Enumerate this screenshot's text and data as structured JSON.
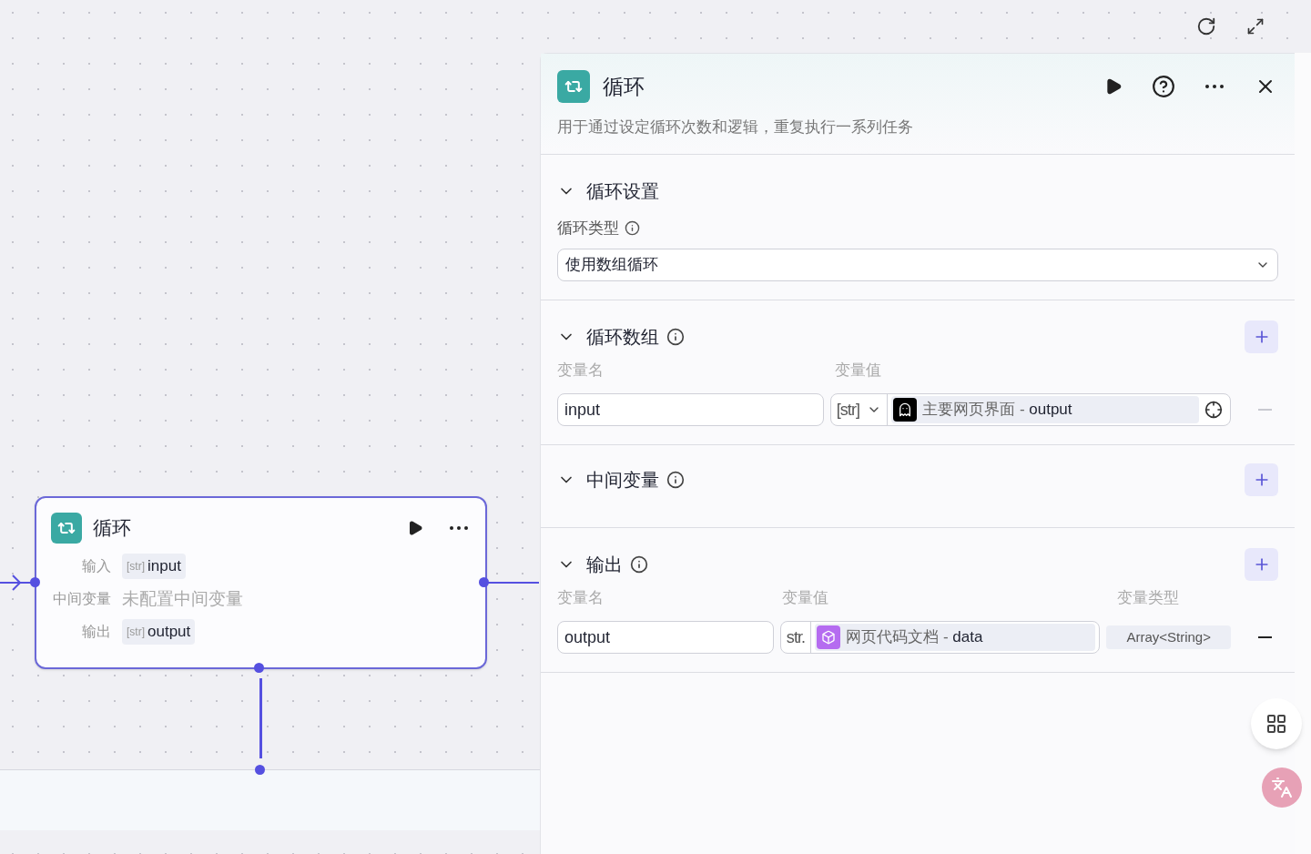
{
  "node": {
    "title": "循环",
    "rows": [
      {
        "label": "输入",
        "kind": "variable",
        "type": "[str]",
        "value": "input"
      },
      {
        "label": "中间变量",
        "kind": "empty",
        "value": "未配置中间变量"
      },
      {
        "label": "输出",
        "kind": "variable",
        "type": "[str]",
        "value": "output"
      }
    ]
  },
  "panel": {
    "title": "循环",
    "description": "用于通过设定循环次数和逻辑，重复执行一系列任务",
    "sections": [
      {
        "kind": "select",
        "title": "循环设置",
        "expanded": true,
        "info": false,
        "add": false,
        "field_label": "循环类型",
        "value": "使用数组循环"
      },
      {
        "kind": "variables",
        "title": "循环数组",
        "expanded": true,
        "info": true,
        "add": true,
        "columns": [
          "变量名",
          "变量值"
        ],
        "rows": [
          {
            "name": "input",
            "type": "[str]",
            "type_dropdown": true,
            "source": {
              "kind": "bot",
              "text": "主要网页界面 - **output**"
            },
            "remove_disabled": true
          }
        ]
      },
      {
        "kind": "empty",
        "title": "中间变量",
        "expanded": true,
        "info": true,
        "add": true
      },
      {
        "kind": "outputs",
        "title": "输出",
        "expanded": true,
        "info": true,
        "add": true,
        "columns": [
          "变量名",
          "变量值",
          "变量类型"
        ],
        "rows": [
          {
            "name": "output",
            "type": "str.",
            "type_dropdown": false,
            "source": {
              "kind": "box",
              "text": "网页代码文档 - **data**"
            },
            "value_type": "Array<String>",
            "remove_disabled": false
          }
        ]
      }
    ]
  }
}
